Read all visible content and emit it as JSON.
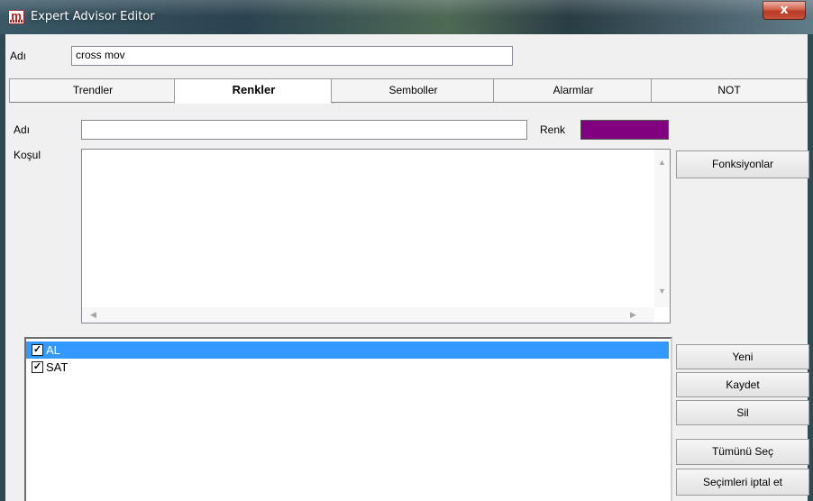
{
  "window": {
    "title": "Expert Advisor Editor",
    "app_icon": "m",
    "close_glyph": "x"
  },
  "top": {
    "name_label": "Adı",
    "name_value": "cross mov"
  },
  "tabs": [
    {
      "label": "Trendler",
      "active": false
    },
    {
      "label": "Renkler",
      "active": true
    },
    {
      "label": "Semboller",
      "active": false
    },
    {
      "label": "Alarmlar",
      "active": false
    },
    {
      "label": "NOT",
      "active": false
    }
  ],
  "renkler": {
    "name_label": "Adı",
    "name_value": "",
    "color_label": "Renk",
    "color_value": "#800080",
    "condition_label": "Koşul",
    "condition_value": "",
    "functions_button": "Fonksiyonlar"
  },
  "list": {
    "items": [
      {
        "label": "AL",
        "checked": true,
        "selected": true
      },
      {
        "label": "SAT",
        "checked": true,
        "selected": false
      }
    ]
  },
  "buttons": {
    "new": "Yeni",
    "save": "Kaydet",
    "delete": "Sil",
    "select_all": "Tümünü Seç",
    "deselect": "Seçimleri iptal et"
  }
}
